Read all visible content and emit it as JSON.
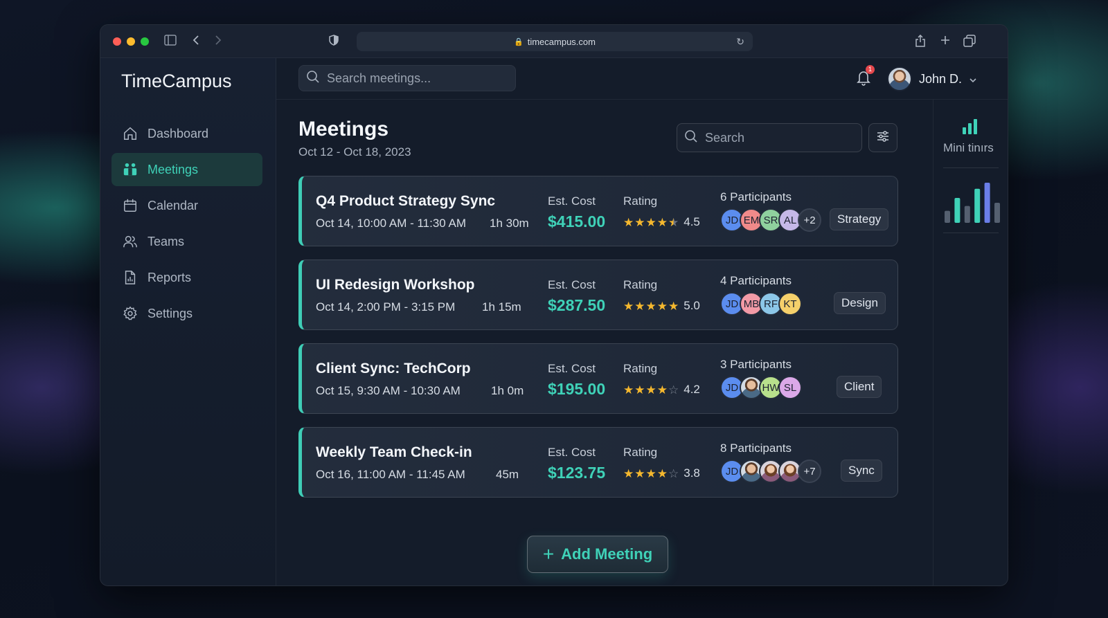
{
  "browser": {
    "url": "timecampus.com"
  },
  "sidebar": {
    "brand": "TimeCampus",
    "items": [
      {
        "label": "Dashboard",
        "icon": "home-icon",
        "active": false
      },
      {
        "label": "Meetings",
        "icon": "meetings-icon",
        "active": true
      },
      {
        "label": "Calendar",
        "icon": "calendar-icon",
        "active": false
      },
      {
        "label": "Teams",
        "icon": "users-icon",
        "active": false
      },
      {
        "label": "Reports",
        "icon": "report-icon",
        "active": false
      },
      {
        "label": "Settings",
        "icon": "gear-icon",
        "active": false
      }
    ]
  },
  "topbar": {
    "search_placeholder": "Search meetings...",
    "notification_count": "1",
    "user_name": "John D."
  },
  "page": {
    "title": "Meetings",
    "date_range": "Oct 12 - Oct 18, 2023",
    "search_placeholder": "Search"
  },
  "meetings": [
    {
      "title": "Q4 Product Strategy Sync",
      "time": "Oct 14, 10:00 AM - 11:30 AM",
      "duration": "1h 30m",
      "cost_label": "Est. Cost",
      "cost": "$415.00",
      "rating_label": "Rating",
      "rating": "4.5",
      "participants_label": "6 Participants",
      "participants": [
        {
          "initials": "JD",
          "color": "#5b8def"
        },
        {
          "initials": "EM",
          "color": "#f08a8a"
        },
        {
          "initials": "SR",
          "color": "#8fd19e"
        },
        {
          "initials": "AL",
          "color": "#c5b8e8"
        },
        {
          "initials": "+2",
          "color": "more"
        }
      ],
      "tag": "Strategy"
    },
    {
      "title": "UI Redesign Workshop",
      "time": "Oct 14, 2:00 PM - 3:15 PM",
      "duration": "1h 15m",
      "cost_label": "Est. Cost",
      "cost": "$287.50",
      "rating_label": "Rating",
      "rating": "5.0",
      "participants_label": "4 Participants",
      "participants": [
        {
          "initials": "JD",
          "color": "#5b8def"
        },
        {
          "initials": "MB",
          "color": "#f29aa6"
        },
        {
          "initials": "RF",
          "color": "#8cc7e8"
        },
        {
          "initials": "KT",
          "color": "#f5d06b"
        }
      ],
      "tag": "Design"
    },
    {
      "title": "Client Sync: TechCorp",
      "time": "Oct 15, 9:30 AM - 10:30 AM",
      "duration": "1h 0m",
      "cost_label": "Est. Cost",
      "cost": "$195.00",
      "rating_label": "Rating",
      "rating": "4.2",
      "participants_label": "3 Participants",
      "participants": [
        {
          "initials": "JD",
          "color": "#5b8def"
        },
        {
          "initials": "",
          "color": "photo"
        },
        {
          "initials": "HW",
          "color": "#b8e08c"
        },
        {
          "initials": "SL",
          "color": "#dba8e8"
        }
      ],
      "tag": "Client"
    },
    {
      "title": "Weekly Team Check-in",
      "time": "Oct 16, 11:00 AM - 11:45 AM",
      "duration": "45m",
      "cost_label": "Est. Cost",
      "cost": "$123.75",
      "rating_label": "Rating",
      "rating": "3.8",
      "participants_label": "8 Participants",
      "participants": [
        {
          "initials": "JD",
          "color": "#5b8def"
        },
        {
          "initials": "",
          "color": "photo"
        },
        {
          "initials": "",
          "color": "photo-f"
        },
        {
          "initials": "",
          "color": "photo-f"
        },
        {
          "initials": "+7",
          "color": "more"
        }
      ],
      "tag": "Sync"
    }
  ],
  "add_button": "Add Meeting",
  "right_panel": {
    "label": "Mini tinırs",
    "bar_levels": [
      0.3,
      0.62,
      0.42,
      0.85,
      1.0,
      0.5
    ]
  },
  "colors": {
    "accent": "#3fd2b8",
    "star": "#f5b82e"
  }
}
